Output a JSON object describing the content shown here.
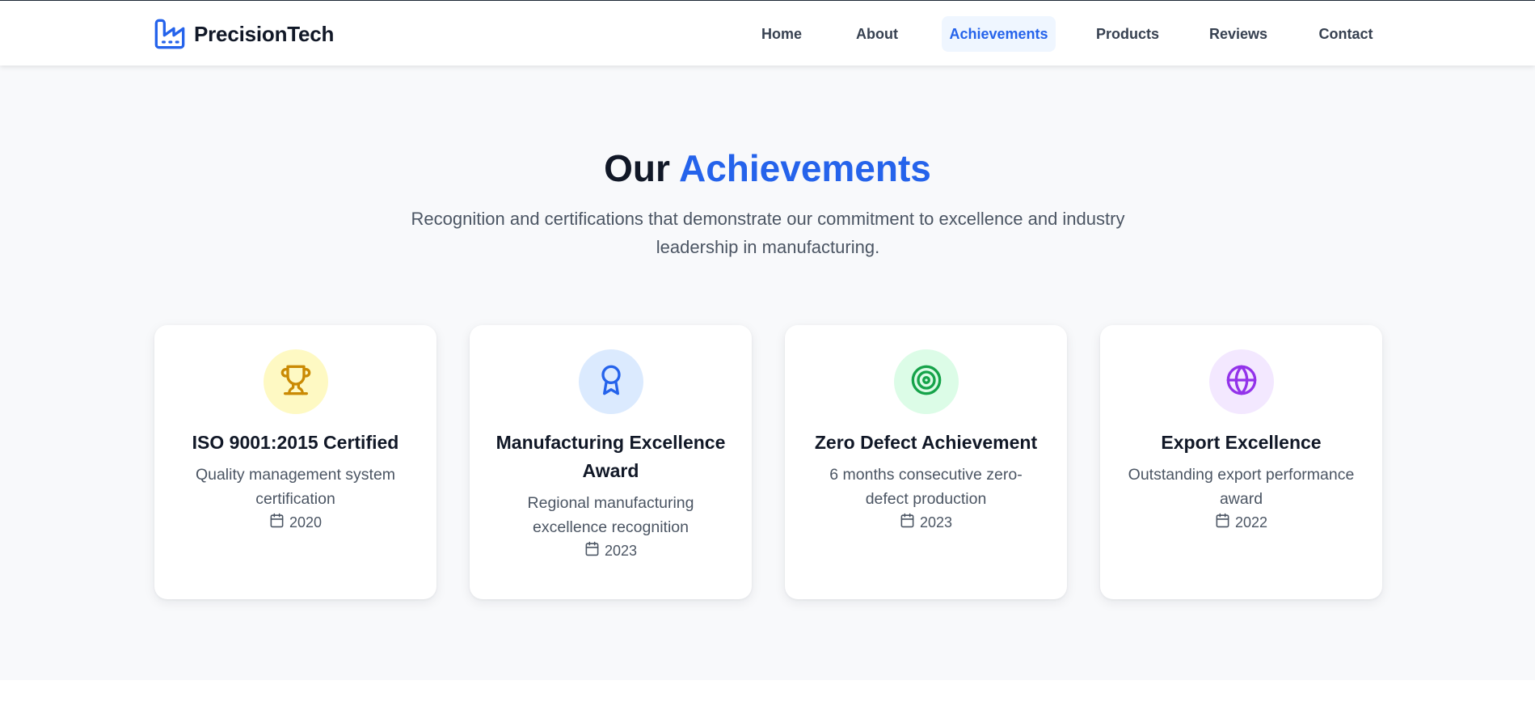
{
  "brand": {
    "name": "PrecisionTech",
    "logo_icon": "factory-icon",
    "accent": "#2563eb"
  },
  "nav": {
    "items": [
      {
        "label": "Home",
        "active": false
      },
      {
        "label": "About",
        "active": false
      },
      {
        "label": "Achievements",
        "active": true
      },
      {
        "label": "Products",
        "active": false
      },
      {
        "label": "Reviews",
        "active": false
      },
      {
        "label": "Contact",
        "active": false
      }
    ]
  },
  "section": {
    "title_prefix": "Our",
    "title_accent": "Achievements",
    "subtitle": "Recognition and certifications that demonstrate our commitment to excellence and industry leadership in manufacturing."
  },
  "achievements": [
    {
      "icon": "trophy-icon",
      "icon_color": "#ca8a04",
      "bg_color": "#fef9c3",
      "title": "ISO 9001:2015 Certified",
      "description": "Quality management system certification",
      "year": "2020"
    },
    {
      "icon": "award-ribbon-icon",
      "icon_color": "#2563eb",
      "bg_color": "#dbeafe",
      "title": "Manufacturing Excellence Award",
      "description": "Regional manufacturing excellence recognition",
      "year": "2023"
    },
    {
      "icon": "target-icon",
      "icon_color": "#16a34a",
      "bg_color": "#dcfce7",
      "title": "Zero Defect Achievement",
      "description": "6 months consecutive zero-defect production",
      "year": "2023"
    },
    {
      "icon": "globe-icon",
      "icon_color": "#9333ea",
      "bg_color": "#f3e8ff",
      "title": "Export Excellence",
      "description": "Outstanding export performance award",
      "year": "2022"
    }
  ]
}
